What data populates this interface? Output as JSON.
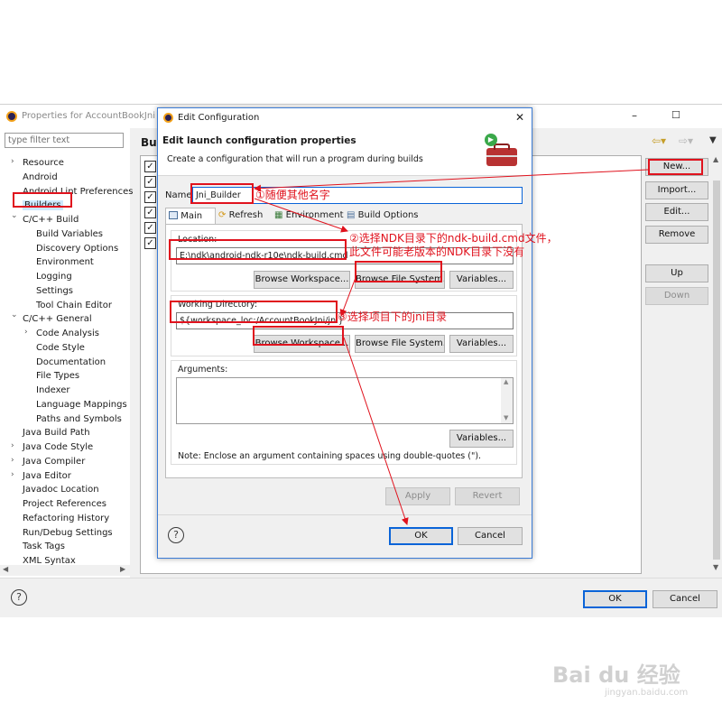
{
  "main_window": {
    "title": "Properties for AccountBookJni",
    "filter_placeholder": "type filter text",
    "content_header": "Bui",
    "tree": [
      {
        "label": "Resource",
        "expandable": true
      },
      {
        "label": "Android",
        "expandable": false
      },
      {
        "label": "Android Lint Preferences",
        "expandable": false
      },
      {
        "label": "Builders",
        "expandable": false,
        "selected": true
      },
      {
        "label": "C/C++ Build",
        "expandable": true,
        "expanded": true
      },
      {
        "label": "Build Variables",
        "child": true
      },
      {
        "label": "Discovery Options",
        "child": true
      },
      {
        "label": "Environment",
        "child": true
      },
      {
        "label": "Logging",
        "child": true
      },
      {
        "label": "Settings",
        "child": true
      },
      {
        "label": "Tool Chain Editor",
        "child": true
      },
      {
        "label": "C/C++ General",
        "expandable": true,
        "expanded": true
      },
      {
        "label": "Code Analysis",
        "child": true,
        "expandable": true
      },
      {
        "label": "Code Style",
        "child": true
      },
      {
        "label": "Documentation",
        "child": true
      },
      {
        "label": "File Types",
        "child": true
      },
      {
        "label": "Indexer",
        "child": true
      },
      {
        "label": "Language Mappings",
        "child": true
      },
      {
        "label": "Paths and Symbols",
        "child": true
      },
      {
        "label": "Java Build Path",
        "expandable": false
      },
      {
        "label": "Java Code Style",
        "expandable": true
      },
      {
        "label": "Java Compiler",
        "expandable": true
      },
      {
        "label": "Java Editor",
        "expandable": true
      },
      {
        "label": "Javadoc Location",
        "expandable": false
      },
      {
        "label": "Project References",
        "expandable": false
      },
      {
        "label": "Refactoring History",
        "expandable": false
      },
      {
        "label": "Run/Debug Settings",
        "expandable": false
      },
      {
        "label": "Task Tags",
        "expandable": false
      },
      {
        "label": "XML Syntax",
        "expandable": false
      }
    ],
    "side_buttons": {
      "new": "New...",
      "import": "Import...",
      "edit": "Edit...",
      "remove": "Remove",
      "up": "Up",
      "down": "Down"
    },
    "ok": "OK",
    "cancel": "Cancel",
    "window_controls": {
      "minimize": "–",
      "maximize": "☐"
    }
  },
  "dialog": {
    "title": "Edit Configuration",
    "close": "✕",
    "heading": "Edit launch configuration properties",
    "subheading": "Create a configuration that will run a program during builds",
    "name_label": "Name:",
    "name_value": "Jni_Builder",
    "tabs": [
      "Main",
      "Refresh",
      "Environment",
      "Build Options"
    ],
    "location_label": "Location:",
    "location_value": "E:\\ndk\\android-ndk-r10e\\ndk-build.cmd",
    "browse_workspace": "Browse Workspace...",
    "browse_file_system": "Browse File System...",
    "variables": "Variables...",
    "working_dir_label": "Working Directory:",
    "working_dir_value": "${workspace_loc:/AccountBookJni/jni}",
    "arguments_label": "Arguments:",
    "note": "Note: Enclose an argument containing spaces using double-quotes (\").",
    "apply": "Apply",
    "revert": "Revert",
    "ok": "OK",
    "cancel": "Cancel"
  },
  "annotations": {
    "step1": "①随便其他名字",
    "step2_line1": "②选择NDK目录下的ndk-build.cmd文件，",
    "step2_line2": "此文件可能老版本的NDK目录下没有",
    "step3": "③选择项目下的jni目录"
  },
  "watermark": {
    "brand": "Bai du 经验",
    "url": "jingyan.baidu.com"
  },
  "colors": {
    "annotation_red": "#e0121d",
    "selection_blue": "#cce8ff",
    "focus_blue": "#0a64d8"
  }
}
